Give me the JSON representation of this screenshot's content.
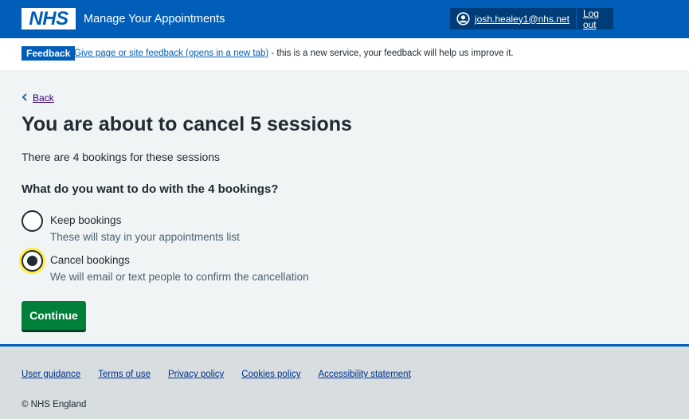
{
  "header": {
    "logo_text": "NHS",
    "service_name": "Manage Your Appointments",
    "user_icon": "user-circle-icon",
    "user_email": "josh.healey1@nhs.net",
    "logout_label": "Log out"
  },
  "feedback": {
    "tag": "Feedback",
    "link_text": "Give page or site feedback (opens in a new tab)",
    "suffix_text": " - this is a new service, your feedback will help us improve it."
  },
  "back": {
    "icon": "chevron-left-icon",
    "label": "Back"
  },
  "main": {
    "title": "You are about to cancel 5 sessions",
    "intro": "There are 4 bookings for these sessions",
    "question": "What do you want to do with the 4 bookings?",
    "options": [
      {
        "label": "Keep bookings",
        "hint": "These will stay in your appointments list",
        "selected": false
      },
      {
        "label": "Cancel bookings",
        "hint": "We will email or text people to confirm the cancellation",
        "selected": true
      }
    ],
    "continue_label": "Continue"
  },
  "footer": {
    "links": [
      "User guidance",
      "Terms of use",
      "Privacy policy",
      "Cookies policy",
      "Accessibility statement"
    ],
    "copyright": "© NHS England"
  },
  "colors": {
    "nhs_blue": "#005eb8",
    "button_green": "#007f3b",
    "focus_yellow": "#ffeb3b",
    "page_background": "#f0f4f5",
    "footer_background": "#d8dde0"
  }
}
